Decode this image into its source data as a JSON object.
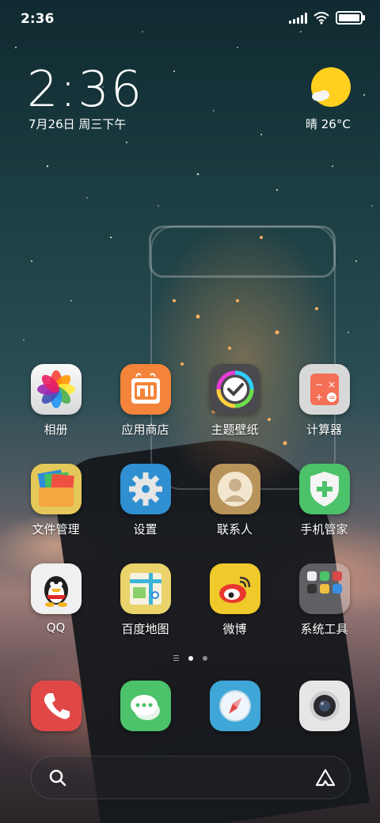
{
  "status_bar": {
    "time": "2:36",
    "battery_level": 1.0
  },
  "clock_widget": {
    "time": "2:36",
    "date": "7月26日 周三下午"
  },
  "weather_widget": {
    "text": "晴 26°C",
    "icon": "sunny-cloud-icon"
  },
  "apps": [
    {
      "label": "相册",
      "icon": "photos-icon"
    },
    {
      "label": "应用商店",
      "icon": "app-store-icon"
    },
    {
      "label": "主题壁纸",
      "icon": "themes-icon"
    },
    {
      "label": "计算器",
      "icon": "calculator-icon"
    },
    {
      "label": "文件管理",
      "icon": "file-manager-icon"
    },
    {
      "label": "设置",
      "icon": "settings-gear-icon"
    },
    {
      "label": "联系人",
      "icon": "contacts-icon"
    },
    {
      "label": "手机管家",
      "icon": "security-shield-icon"
    },
    {
      "label": "QQ",
      "icon": "qq-penguin-icon"
    },
    {
      "label": "百度地图",
      "icon": "baidu-map-icon"
    },
    {
      "label": "微博",
      "icon": "weibo-icon"
    },
    {
      "label": "系统工具",
      "icon": "system-tools-folder-icon"
    }
  ],
  "page_indicator": {
    "pages": 2,
    "current": 1
  },
  "dock": [
    {
      "icon": "phone-icon"
    },
    {
      "icon": "messages-icon"
    },
    {
      "icon": "browser-compass-icon"
    },
    {
      "icon": "camera-icon"
    }
  ],
  "search_bar": {
    "left_icon": "search-icon",
    "right_icon": "assistant-logo-icon"
  }
}
